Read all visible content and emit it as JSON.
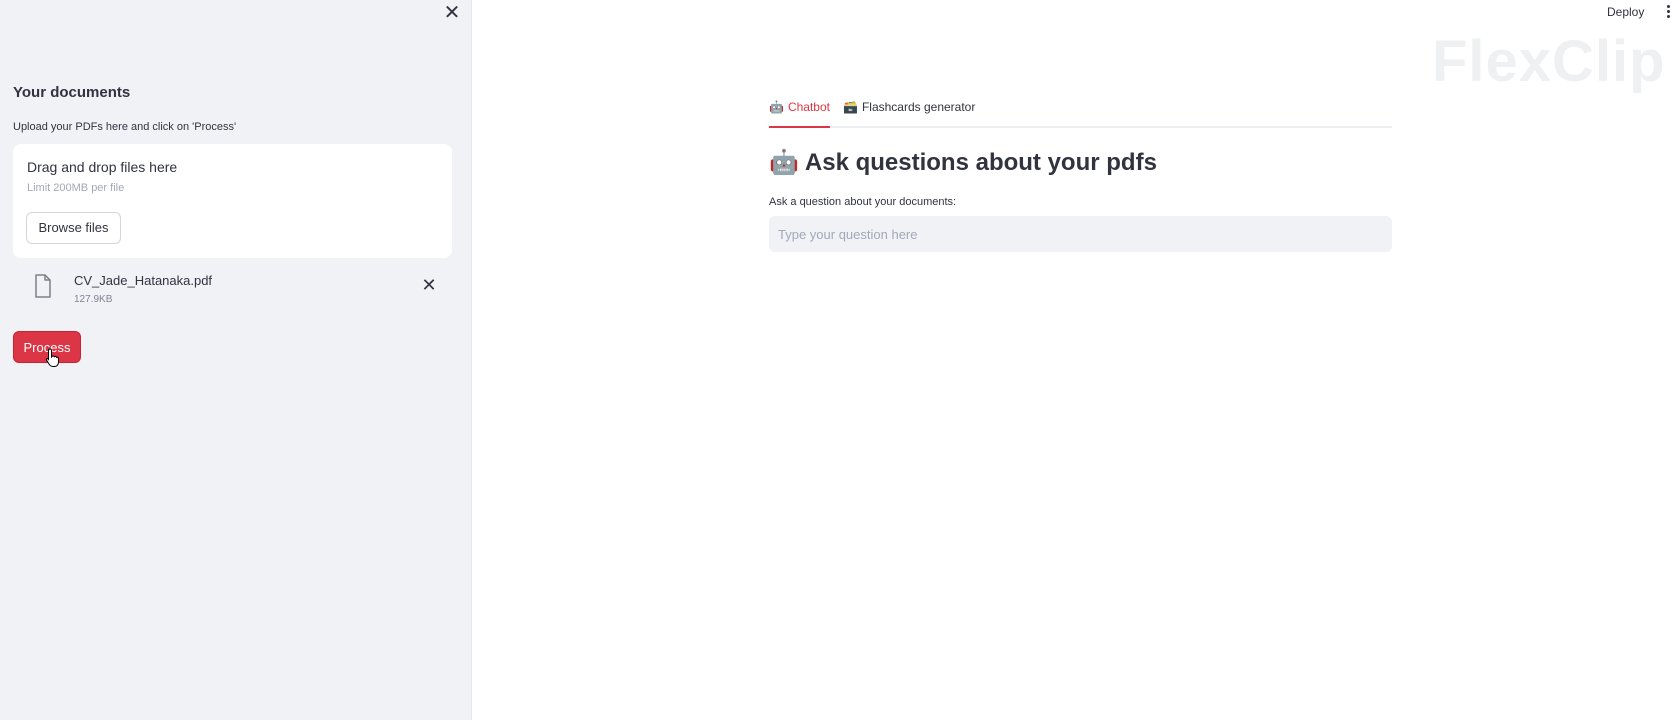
{
  "sidebar": {
    "close_glyph": "✕",
    "title": "Your documents",
    "help": "Upload your PDFs here and click on 'Process'",
    "uploader": {
      "title": "Drag and drop files here",
      "limit": "Limit 200MB per file",
      "browse_label": "Browse files"
    },
    "files": [
      {
        "name": "CV_Jade_Hatanaka.pdf",
        "size": "127.9KB",
        "icon": "file-icon",
        "remove_glyph": "✕"
      }
    ],
    "process_label": "Process"
  },
  "topbar": {
    "deploy_label": "Deploy",
    "menu_icon": "more-vertical-icon",
    "watermark": "FlexClip"
  },
  "main": {
    "tabs": [
      {
        "emoji": "🤖",
        "label": "Chatbot",
        "active": true
      },
      {
        "emoji": "🗃️",
        "label": "Flashcards generator",
        "active": false
      }
    ],
    "heading_emoji": "🤖",
    "heading": "Ask questions about your pdfs",
    "question_label": "Ask a question about your documents:",
    "question_placeholder": "Type your question here",
    "question_value": ""
  },
  "colors": {
    "accent": "#dc3545",
    "sidebar_bg": "#f0f2f6",
    "text": "#31333f"
  }
}
